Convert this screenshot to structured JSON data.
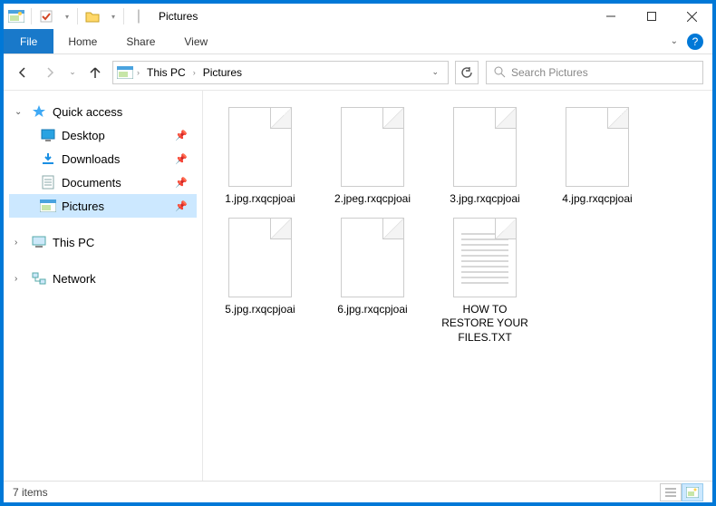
{
  "window": {
    "title": "Pictures"
  },
  "ribbon": {
    "file": "File",
    "tabs": [
      "Home",
      "Share",
      "View"
    ]
  },
  "nav": {
    "crumbs": [
      "This PC",
      "Pictures"
    ],
    "search_placeholder": "Search Pictures"
  },
  "sidebar": {
    "quick_access": "Quick access",
    "items": [
      {
        "label": "Desktop",
        "icon": "desktop"
      },
      {
        "label": "Downloads",
        "icon": "downloads"
      },
      {
        "label": "Documents",
        "icon": "documents"
      },
      {
        "label": "Pictures",
        "icon": "pictures",
        "selected": true
      }
    ],
    "this_pc": "This PC",
    "network": "Network"
  },
  "files": [
    {
      "name": "1.jpg.rxqcpjoai",
      "type": "blank"
    },
    {
      "name": "2.jpeg.rxqcpjoai",
      "type": "blank"
    },
    {
      "name": "3.jpg.rxqcpjoai",
      "type": "blank"
    },
    {
      "name": "4.jpg.rxqcpjoai",
      "type": "blank"
    },
    {
      "name": "5.jpg.rxqcpjoai",
      "type": "blank"
    },
    {
      "name": "6.jpg.rxqcpjoai",
      "type": "blank"
    },
    {
      "name": "HOW TO RESTORE YOUR FILES.TXT",
      "type": "txt"
    }
  ],
  "status": {
    "count_label": "7 items"
  }
}
